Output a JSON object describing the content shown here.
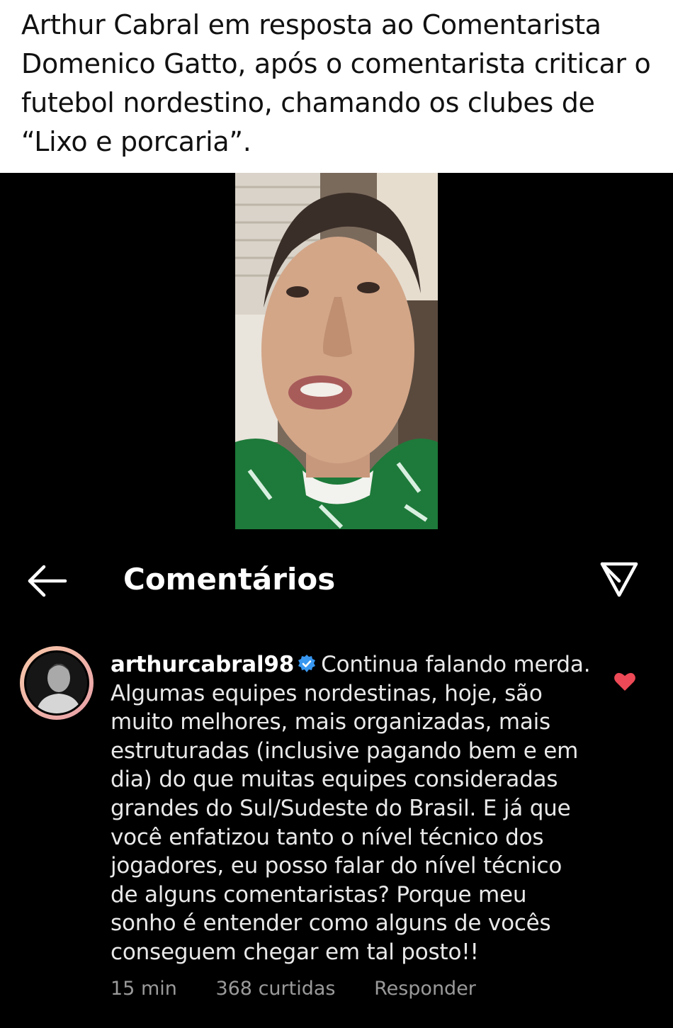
{
  "caption": {
    "text": "Arthur Cabral em resposta ao Comentarista Domenico Gatto, após o comentarista criticar o futebol nordestino, chamando os clubes de “Lixo e porcaria”."
  },
  "header": {
    "title": "Comentários",
    "back_icon": "arrow-left-icon",
    "share_icon": "paper-plane-icon"
  },
  "comment": {
    "username": "arthurcabral98",
    "verified_icon": "verified-badge-icon",
    "text": "Continua falando merda. Algumas equipes nordestinas, hoje, são muito melhores, mais organizadas, mais estruturadas (inclusive pagando bem e em dia) do que muitas equipes consideradas grandes do Sul/Sudeste do Brasil. E já que você enfatizou tanto o nível técnico dos jogadores, eu posso falar do nível técnico de alguns comentaristas? Porque meu sonho é entender como alguns de vocês conseguem chegar em tal posto!!",
    "time": "15 min",
    "likes": "368 curtidas",
    "reply_label": "Responder",
    "liked": true
  },
  "colors": {
    "background": "#000000",
    "caption_bg": "#ffffff",
    "verified": "#3897f0",
    "heart": "#ed4956",
    "meta_text": "#9a9a9a"
  }
}
